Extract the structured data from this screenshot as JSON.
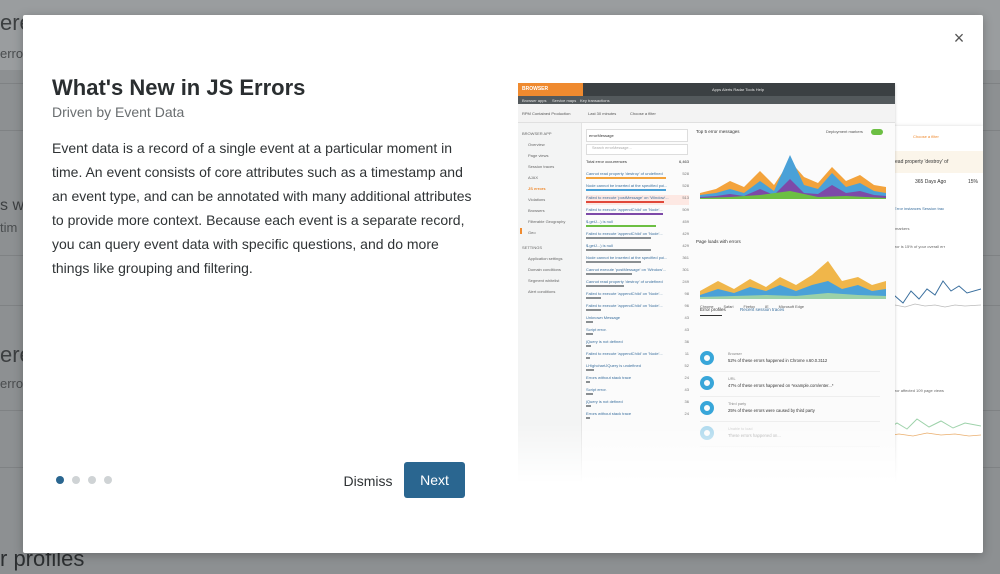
{
  "background": {
    "fragments": [
      "ere",
      "erro",
      "s w",
      "tim",
      "ere",
      "erro",
      "r profiles"
    ]
  },
  "modal": {
    "title": "What's New in JS Errors",
    "subtitle": "Driven by Event Data",
    "body": "Event data is a record of a single event at a particular moment in time. An event consists of core attributes such as a timestamp and an event type, and can be annotated with many additional attributes to provide more context. Because each event is a separate record, you can query event data with specific questions, and do more things like grouping and filtering.",
    "close_label": "×",
    "pagination": {
      "current": 1,
      "total": 4
    },
    "dismiss_label": "Dismiss",
    "next_label": "Next",
    "accent_color": "#2a6690"
  },
  "screenshot": {
    "brand": "BROWSER",
    "top_menu": "Apps    Alerts    Radar    Tools    Help",
    "subnav": [
      "Browser apps",
      "Service maps",
      "Key transactions"
    ],
    "app_name": "RPM Contained Production",
    "time_picker": "Last 30 minutes",
    "filter": "Choose a filter",
    "sidebar": [
      "BROWSER APP",
      "Overview",
      "Page views",
      "Session traces",
      "AJAX",
      "JS errors",
      "Violations",
      "Browsers",
      "Filterable Geography",
      "Geo",
      "SETTINGS",
      "Application settings",
      "Domain conditions",
      "Segment whitelist",
      "Alert conditions"
    ],
    "active_sidebar": "JS errors",
    "facet": "errorMessage",
    "search_placeholder": "Search errorMessage...",
    "total_label": "Total error occurrences",
    "total_value": "6,463",
    "errors": [
      {
        "t": "Cannot read property 'destroy' of undefined",
        "v": "528"
      },
      {
        "t": "Node cannot be inserted at the specified poi...",
        "v": "528"
      },
      {
        "t": "Failed to execute 'postMessage' on 'Window'...",
        "v": "513"
      },
      {
        "t": "Failed to execute 'appendChild' on 'Node'...",
        "v": "509"
      },
      {
        "t": "$.getJ...) is null",
        "v": "459"
      },
      {
        "t": "Failed to execute 'appendChild' on 'Node'...",
        "v": "429"
      },
      {
        "t": "$.getJ...) is null",
        "v": "429"
      },
      {
        "t": "Node cannot be inserted at the specified poi...",
        "v": "361"
      },
      {
        "t": "Cannot execute 'postMessage' on 'Window'...",
        "v": "301"
      },
      {
        "t": "Cannot read property 'destroy' of undefined",
        "v": "249"
      },
      {
        "t": "Failed to execute 'appendChild' on 'Node'...",
        "v": "98"
      },
      {
        "t": "Failed to execute 'appendChild' on 'Node'...",
        "v": "96"
      },
      {
        "t": "Unknown Message",
        "v": "43"
      },
      {
        "t": "Script error.",
        "v": "43"
      },
      {
        "t": "jQuery is not defined",
        "v": "36"
      },
      {
        "t": "Failed to execute 'appendChild' on 'Node'...",
        "v": "11"
      },
      {
        "t": "LHighchartJQuery is undefined",
        "v": "52"
      },
      {
        "t": "Errors without stack trace",
        "v": "24"
      },
      {
        "t": "Script error.",
        "v": "43"
      },
      {
        "t": "jQuery is not defined",
        "v": "36"
      },
      {
        "t": "Errors without stack trace",
        "v": "24"
      }
    ],
    "chart1_title": "Top 5 error messages",
    "chart2_title": "Page loads with errors",
    "deployment_markers": "Deployment markers",
    "legend2": [
      "Chrome",
      "Safari",
      "Firefox",
      "IE",
      "Microsoft Edge"
    ],
    "profiles_tab": "Error profiles",
    "traces_tab": "Recent session traces",
    "profiles": [
      {
        "title": "Browser",
        "desc": "52% of these errors happened in Chrome v.60.0.3112"
      },
      {
        "title": "URL",
        "desc": "47% of these errors happened on *example.com/enter...*"
      },
      {
        "title": "Third party",
        "desc": "25% of these errors were caused by third party"
      },
      {
        "title": "Unable to load",
        "desc": "These errors happened on...",
        "faded": true
      }
    ],
    "back_panel": {
      "filter": "Choose a filter",
      "error": "not read property 'destroy' of",
      "days_ago": "365 Days Ago",
      "pct": "15%",
      "tabs": "view   Error instances   Session trac",
      "deploy": "ment markers",
      "note": "his error is 15% of your overall err",
      "affected": "his error affected 109 page views"
    }
  }
}
